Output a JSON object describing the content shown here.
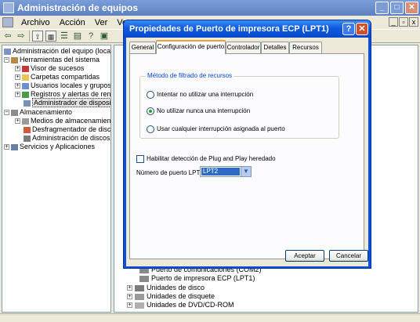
{
  "window": {
    "title": "Administración de equipos",
    "menu": [
      "Archivo",
      "Acción",
      "Ver",
      "Ventana"
    ]
  },
  "tree": {
    "root": "Administración del equipo (local)",
    "items": [
      {
        "label": "Herramientas del sistema",
        "level": 1,
        "expander": "−"
      },
      {
        "label": "Visor de sucesos",
        "level": 2,
        "expander": "+"
      },
      {
        "label": "Carpetas compartidas",
        "level": 2,
        "expander": "+"
      },
      {
        "label": "Usuarios locales y grupos",
        "level": 2,
        "expander": "+"
      },
      {
        "label": "Registros y alertas de rendim",
        "level": 2,
        "expander": "+"
      },
      {
        "label": "Administrador de dispositivos",
        "level": 2,
        "expander": "",
        "selected": true
      },
      {
        "label": "Almacenamiento",
        "level": 1,
        "expander": "−"
      },
      {
        "label": "Medios de almacenamiento e",
        "level": 2,
        "expander": "+"
      },
      {
        "label": "Desfragmentador de disco",
        "level": 2,
        "expander": ""
      },
      {
        "label": "Administración de discos",
        "level": 2,
        "expander": ""
      },
      {
        "label": "Servicios y Aplicaciones",
        "level": 1,
        "expander": "+"
      }
    ]
  },
  "device_list": {
    "items": [
      {
        "label": "Puerto de comunicaciones (COM2)",
        "expander": ""
      },
      {
        "label": "Puerto de impresora ECP (LPT1)",
        "expander": ""
      },
      {
        "label": "Unidades de disco",
        "expander": "+"
      },
      {
        "label": "Unidades de disquete",
        "expander": "+"
      },
      {
        "label": "Unidades de DVD/CD-ROM",
        "expander": "+"
      }
    ]
  },
  "dialog": {
    "title": "Propiedades de Puerto de impresora ECP (LPT1)",
    "help": "?",
    "close": "✕",
    "tabs": [
      "General",
      "Configuración de puerto",
      "Controlador",
      "Detalles",
      "Recursos"
    ],
    "active_tab": "Configuración de puerto",
    "group_title": "Método de filtrado de recursos",
    "radios": [
      {
        "label": "Intentar no utilizar una interrupción",
        "selected": false
      },
      {
        "label": "No utilizar nunca una interrupción",
        "selected": true
      },
      {
        "label": "Usar cualquier interrupción asignada al puerto",
        "selected": false
      }
    ],
    "checkbox": {
      "label": "Habilitar detección de Plug and Play heredado",
      "checked": false
    },
    "port_label": "Número de puerto LPT:",
    "port_value": "LPT2",
    "ok": "Aceptar",
    "cancel": "Cancelar"
  }
}
